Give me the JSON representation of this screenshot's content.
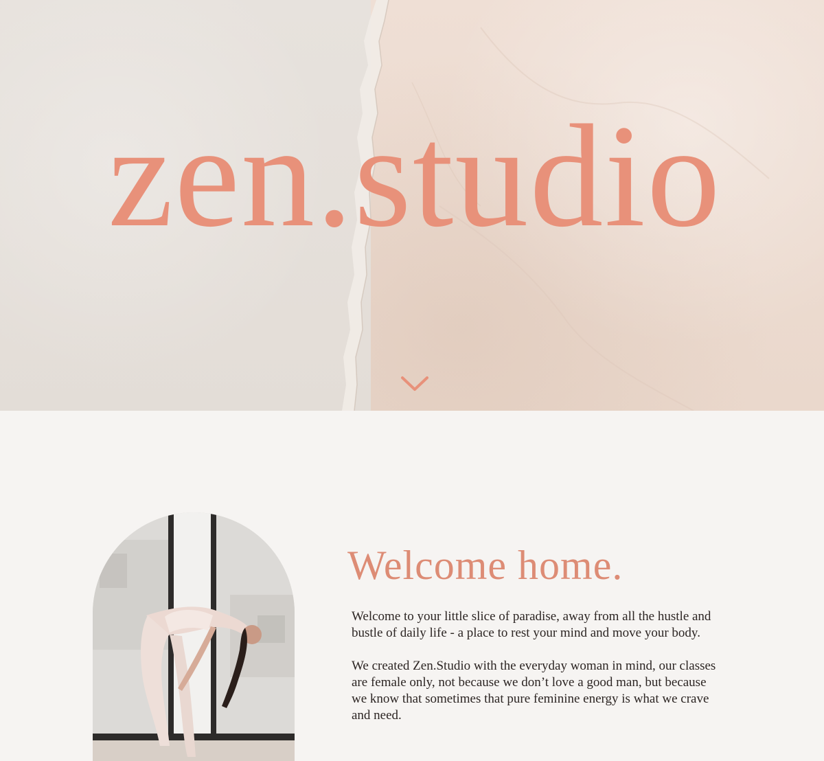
{
  "hero": {
    "brand": "zen.studio",
    "scroll_icon": "chevron-down-icon"
  },
  "welcome": {
    "heading": "Welcome home.",
    "paragraphs": [
      "Welcome to your little slice of paradise, away from all the hustle and bustle of daily life - a place to rest your mind and move your body.",
      "We created Zen.Studio with the everyday woman in mind, our classes are female only, not because we don’t love a good man, but because we know that sometimes that pure feminine energy is what we crave and need."
    ]
  },
  "colors": {
    "accent": "#e8917a",
    "heading": "#dd8c75",
    "body_text": "#2c2523",
    "background": "#f6f4f2"
  }
}
